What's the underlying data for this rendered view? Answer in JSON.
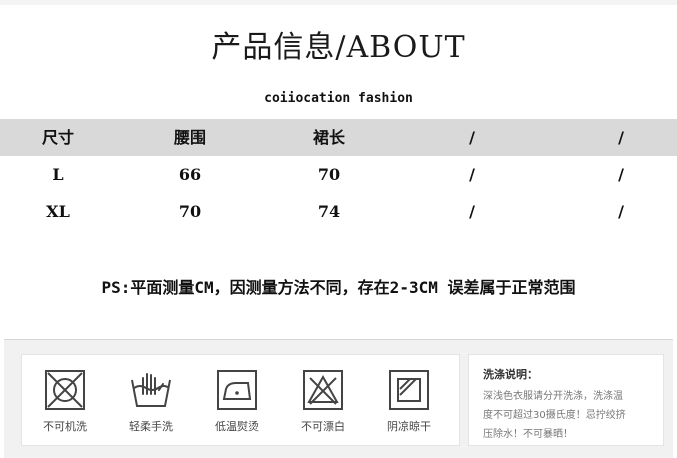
{
  "title": "产品信息/ABOUT",
  "subtitle": "coiiocation fashion",
  "size_table": {
    "headers": [
      "尺寸",
      "腰围",
      "裙长",
      "/",
      "/"
    ],
    "rows": [
      [
        "L",
        "66",
        "70",
        "/",
        "/"
      ],
      [
        "XL",
        "70",
        "74",
        "/",
        "/"
      ]
    ]
  },
  "note": "PS:平面测量CM，因测量方法不同，存在2-3CM 误差属于正常范围",
  "care": {
    "icons": [
      {
        "label": "不可机洗",
        "icon": "no-machine-wash-icon"
      },
      {
        "label": "轻柔手洗",
        "icon": "hand-wash-icon"
      },
      {
        "label": "低温熨烫",
        "icon": "low-iron-icon"
      },
      {
        "label": "不可漂白",
        "icon": "no-bleach-icon"
      },
      {
        "label": "阴凉晾干",
        "icon": "shade-dry-icon"
      }
    ],
    "wash_title": "洗涤说明：",
    "wash_lines": [
      "深浅色衣服请分开洗涤，洗涤温",
      "度不可超过30摄氏度！忌拧绞挤",
      "压除水！不可暴晒！"
    ]
  }
}
